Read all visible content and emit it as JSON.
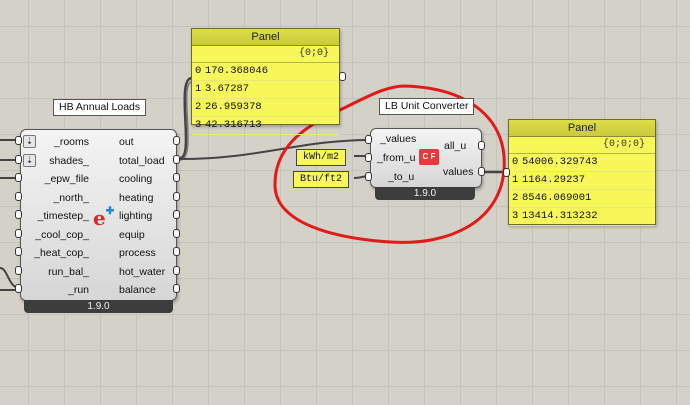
{
  "annual_loads": {
    "title": "HB Annual Loads",
    "inputs": [
      "_rooms",
      "shades_",
      "_epw_file",
      "_north_",
      "_timestep_",
      "_cool_cop_",
      "_heat_cop_",
      "run_bal_",
      "_run"
    ],
    "outputs": [
      "out",
      "total_load",
      "cooling",
      "heating",
      "lighting",
      "equip",
      "process",
      "hot_water",
      "balance"
    ],
    "version": "1.9.0"
  },
  "unit_converter": {
    "title": "LB Unit Converter",
    "inputs": [
      "_values",
      "_from_u",
      "_to_u"
    ],
    "outputs": [
      "all_u",
      "values"
    ],
    "version": "1.9.0",
    "icon_text": "C F"
  },
  "unit_inputs": {
    "from": "kWh/m2",
    "to": "Btu/ft2"
  },
  "panel_top": {
    "title": "Panel",
    "path": "{0;0}",
    "rows": [
      {
        "i": "0",
        "v": "170.368046"
      },
      {
        "i": "1",
        "v": "3.67287"
      },
      {
        "i": "2",
        "v": "26.959378"
      },
      {
        "i": "3",
        "v": "42.316713"
      }
    ]
  },
  "panel_right": {
    "title": "Panel",
    "path": "{0;0;0}",
    "rows": [
      {
        "i": "0",
        "v": "54006.329743"
      },
      {
        "i": "1",
        "v": "1164.29237"
      },
      {
        "i": "2",
        "v": "8546.069001"
      },
      {
        "i": "3",
        "v": "13414.313232"
      }
    ]
  },
  "colors": {
    "annotation": "#e11a1a",
    "panel": "#f7f75a",
    "canvas": "#d4d1c9"
  }
}
